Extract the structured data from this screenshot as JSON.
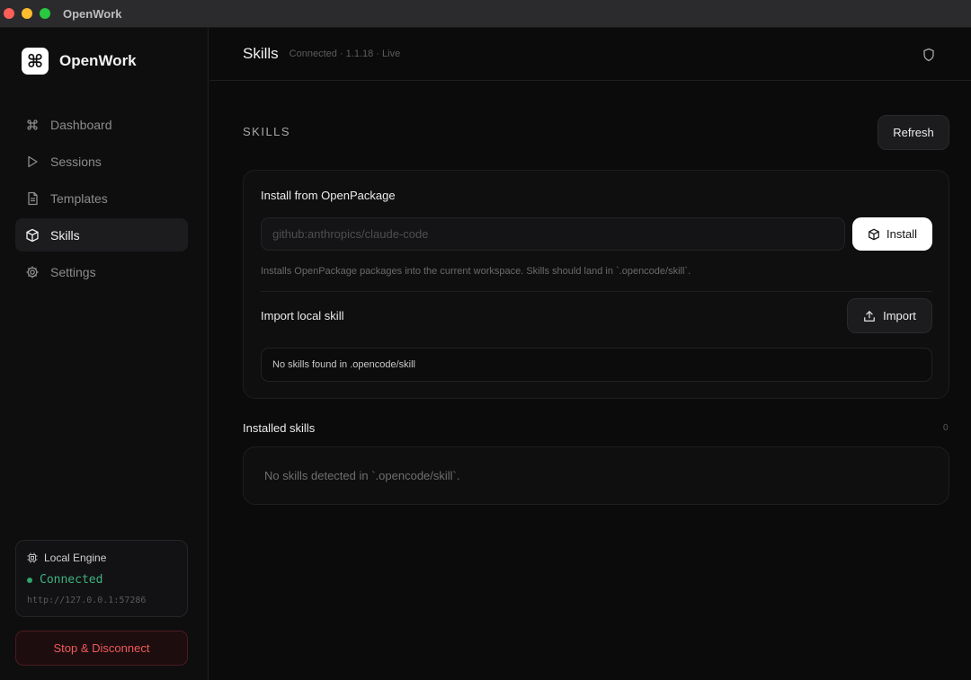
{
  "window": {
    "title": "OpenWork"
  },
  "brand": {
    "logo_glyph": "⌘",
    "name": "OpenWork"
  },
  "nav": {
    "items": [
      {
        "label": "Dashboard",
        "icon": "command-icon",
        "active": false
      },
      {
        "label": "Sessions",
        "icon": "play-icon",
        "active": false
      },
      {
        "label": "Templates",
        "icon": "document-icon",
        "active": false
      },
      {
        "label": "Skills",
        "icon": "box-icon",
        "active": true
      },
      {
        "label": "Settings",
        "icon": "gear-icon",
        "active": false
      }
    ]
  },
  "engine": {
    "title": "Local Engine",
    "icon": "chip-icon",
    "status": "Connected",
    "status_color": "#2ea66e",
    "url": "http://127.0.0.1:57286"
  },
  "disconnect_label": "Stop & Disconnect",
  "header": {
    "title": "Skills",
    "meta": "Connected · 1.1.18 · Live",
    "icon": "shield-icon"
  },
  "skills": {
    "section_title": "SKILLS",
    "refresh_label": "Refresh",
    "install": {
      "title": "Install from OpenPackage",
      "placeholder": "github:anthropics/claude-code",
      "value": "",
      "button_label": "Install",
      "helper": "Installs OpenPackage packages into the current workspace. Skills should land in `.opencode/skill`."
    },
    "import": {
      "title": "Import local skill",
      "button_label": "Import",
      "empty_text": "No skills found in .opencode/skill"
    },
    "installed": {
      "title": "Installed skills",
      "count": "0",
      "empty_text": "No skills detected in `.opencode/skill`."
    }
  }
}
